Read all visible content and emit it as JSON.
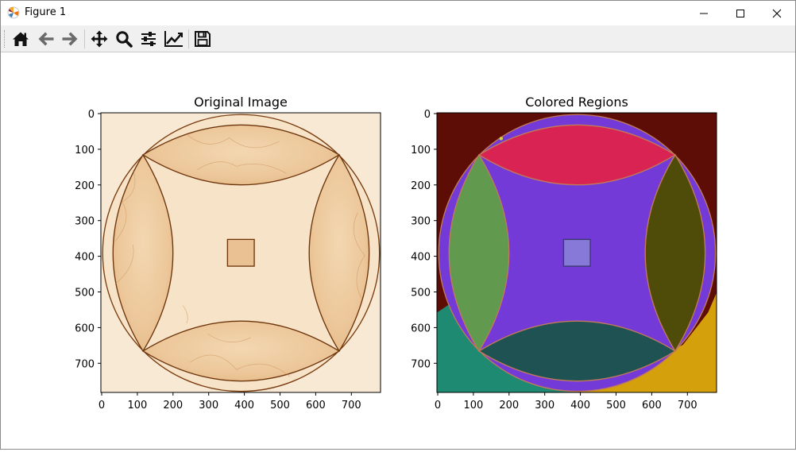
{
  "window": {
    "title": "Figure 1"
  },
  "toolbar": {
    "buttons": [
      {
        "name": "home-button",
        "icon": "home-icon"
      },
      {
        "name": "back-button",
        "icon": "arrow-left-icon"
      },
      {
        "name": "forward-button",
        "icon": "arrow-right-icon"
      },
      {
        "name": "pan-button",
        "icon": "move-icon"
      },
      {
        "name": "zoom-button",
        "icon": "magnifier-icon"
      },
      {
        "name": "configure-subplots-button",
        "icon": "sliders-icon"
      },
      {
        "name": "edit-axes-button",
        "icon": "line-chart-icon"
      },
      {
        "name": "save-button",
        "icon": "floppy-icon"
      }
    ]
  },
  "plots": {
    "left": {
      "title": "Original Image",
      "xticks": [
        "0",
        "100",
        "200",
        "300",
        "400",
        "500",
        "600",
        "700"
      ],
      "yticks": [
        "0",
        "100",
        "200",
        "300",
        "400",
        "500",
        "600",
        "700"
      ]
    },
    "right": {
      "title": "Colored Regions",
      "xticks": [
        "0",
        "100",
        "200",
        "300",
        "400",
        "500",
        "600",
        "700"
      ],
      "yticks": [
        "0",
        "100",
        "200",
        "300",
        "400",
        "500",
        "600",
        "700"
      ],
      "region_colors": {
        "background_top": "#5e0c06",
        "background_bottom_left": "#1f8a72",
        "background_bottom_right": "#d4a00b",
        "lens_top": "#d92353",
        "lens_left": "#619a4f",
        "lens_right": "#4f4b08",
        "lens_bottom": "#1f5252",
        "center_star": "#733ad8",
        "hole": "#8679d8"
      }
    }
  }
}
